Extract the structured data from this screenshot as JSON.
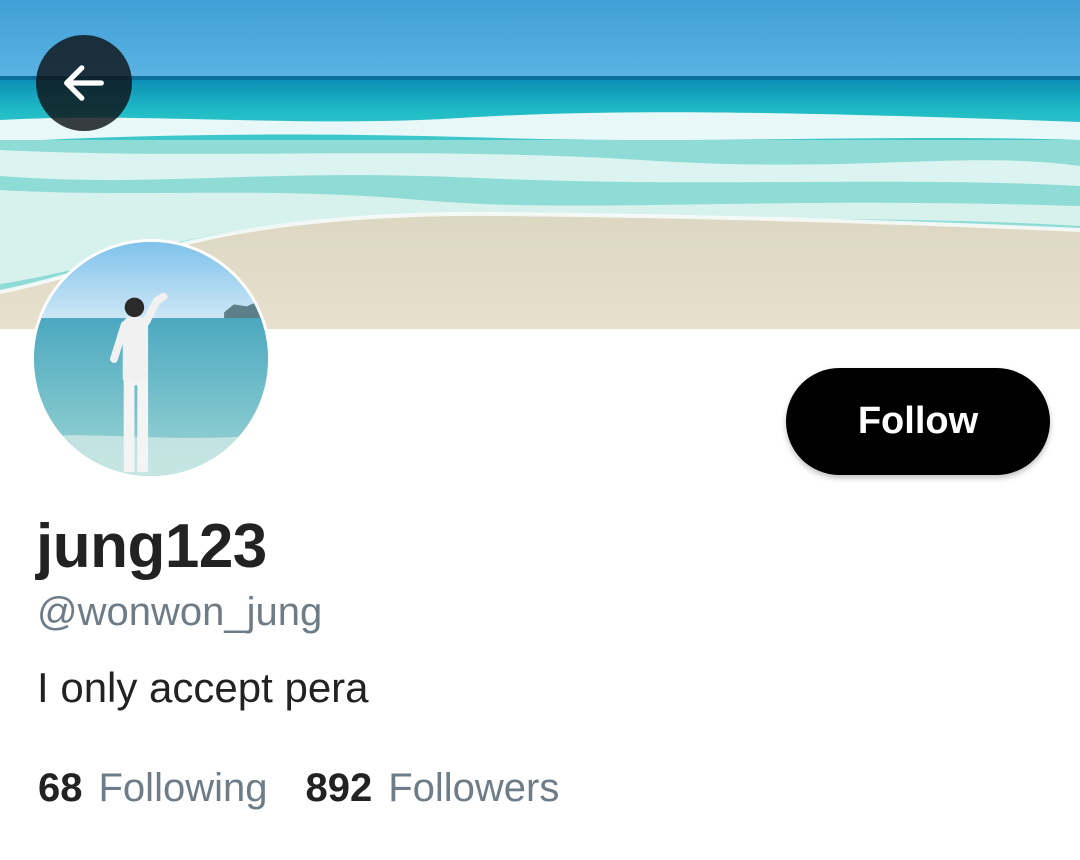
{
  "profile": {
    "display_name": "jung123",
    "handle": "@wonwon_jung",
    "bio": "I only accept pera"
  },
  "actions": {
    "follow_label": "Follow"
  },
  "stats": {
    "following_count": "68",
    "following_label": "Following",
    "followers_count": "892",
    "followers_label": "Followers"
  },
  "icons": {
    "back": "arrow-left-icon"
  },
  "colors": {
    "follow_button_bg": "#000000",
    "follow_button_text": "#ffffff",
    "secondary_text": "#6e7c88",
    "primary_text": "#222222"
  }
}
